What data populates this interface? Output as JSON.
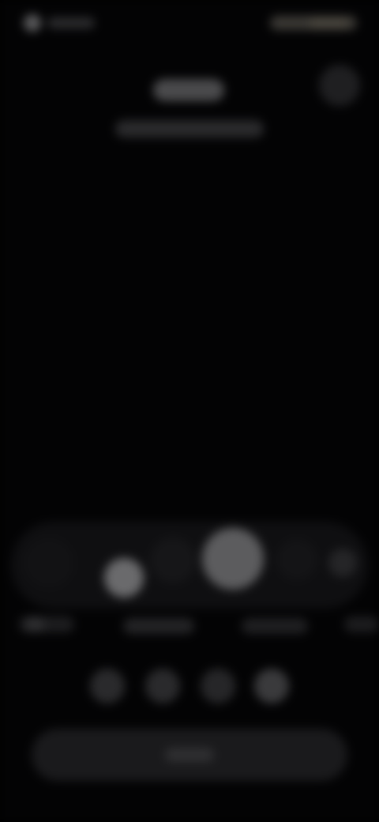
{
  "colors": {
    "background": "#030304",
    "surface": "#1a1a1c",
    "accent_warm": "#4a463e"
  },
  "status_bar": {
    "left_icon": "status-indicator-icon",
    "right_icons": "system-status-icons"
  },
  "header": {
    "corner_icon": "circular-button-icon"
  },
  "mode_wheel": {
    "items": [
      {
        "icon": "mode-icon"
      },
      {
        "icon": "mode-icon"
      },
      {
        "icon": "mode-icon"
      },
      {
        "icon": "mode-icon-selected"
      },
      {
        "icon": "mode-icon"
      },
      {
        "icon": "mode-icon"
      }
    ]
  },
  "dot_row": {
    "count": 4,
    "icon": "option-dot-icon"
  },
  "action_bar": {
    "label": ""
  }
}
